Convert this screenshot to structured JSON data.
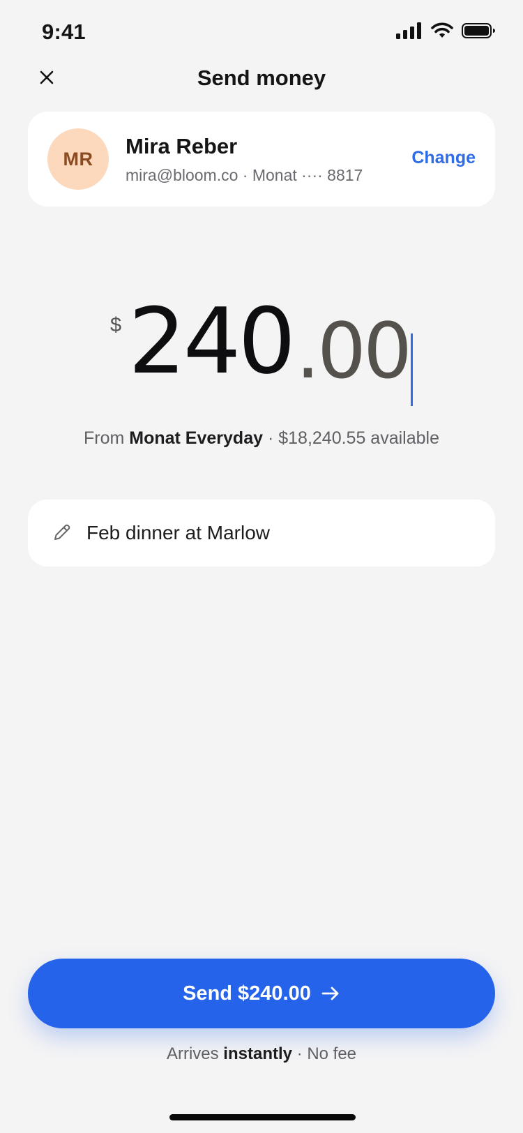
{
  "status_bar": {
    "time": "9:41"
  },
  "nav": {
    "title": "Send money",
    "close_icon": "close-icon"
  },
  "recipient": {
    "initials": "MR",
    "name": "Mira Reber",
    "detail": "mira@bloom.co · Monat ···· 8817",
    "change_label": "Change"
  },
  "amount": {
    "currency": "$",
    "integer": "240",
    "decimal": ".00"
  },
  "source": {
    "prefix": "From",
    "account": "Monat Everyday",
    "available": "· $18,240.55 available"
  },
  "note": {
    "text": "Feb dinner at Marlow",
    "icon": "pencil-icon"
  },
  "send_button": {
    "label": "Send $240.00",
    "icon": "arrow-right-icon"
  },
  "arrival": {
    "prefix": "Arrives",
    "emphasis": "instantly",
    "suffix": "· No fee"
  },
  "colors": {
    "accent": "#2563eb",
    "link": "#2f6ce5",
    "avatar_bg": "#fcd9bd",
    "avatar_text": "#8a4a22",
    "background": "#f4f4f5"
  }
}
